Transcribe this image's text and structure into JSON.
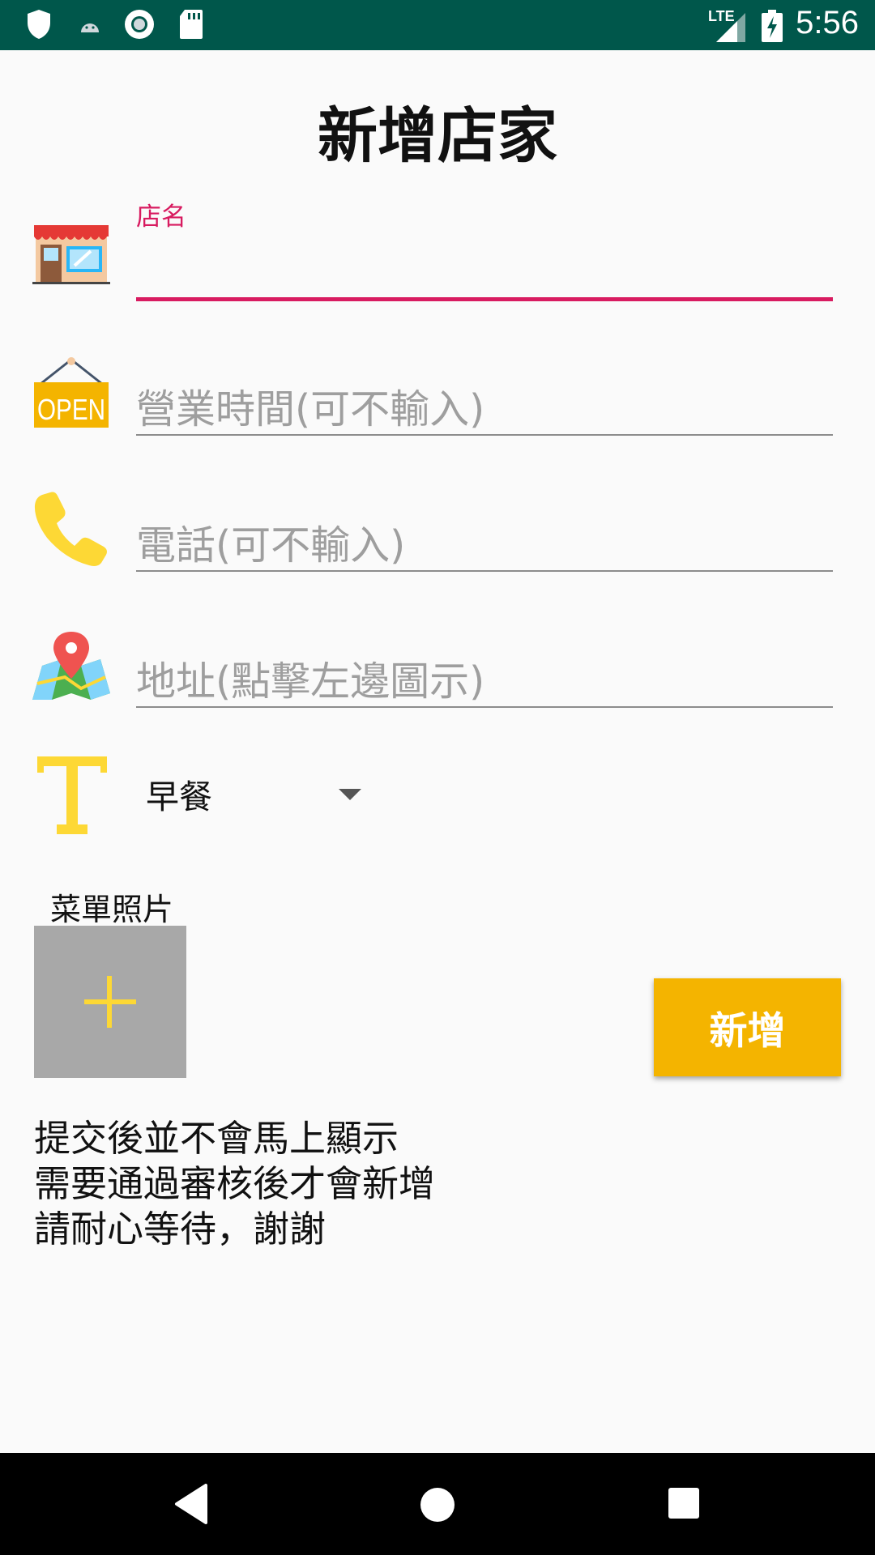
{
  "status_bar": {
    "time": "5:56",
    "network": "LTE",
    "icons": [
      "shield-icon",
      "android-icon",
      "circle-notification-icon",
      "sd-card-icon",
      "signal-icon",
      "battery-charging-icon"
    ]
  },
  "page": {
    "title": "新增店家"
  },
  "form": {
    "store_name": {
      "label": "店名",
      "value": "",
      "icon": "store-icon"
    },
    "hours": {
      "placeholder": "營業時間(可不輸入)",
      "icon": "open-sign-icon"
    },
    "phone": {
      "placeholder": "電話(可不輸入)",
      "icon": "phone-icon"
    },
    "address": {
      "placeholder": "地址(點擊左邊圖示)",
      "icon": "map-pin-icon"
    },
    "category": {
      "selected": "早餐",
      "icon": "text-type-icon"
    },
    "menu_photo": {
      "label": "菜單照片",
      "icon": "plus-icon"
    },
    "submit_label": "新增"
  },
  "notice": {
    "lines": [
      "提交後並不會馬上顯示",
      "需要通過審核後才會新增",
      "請耐心等待，謝謝"
    ]
  },
  "colors": {
    "status_bar": "#00574b",
    "accent": "#d81b60",
    "button": "#f4b400",
    "icon_yellow": "#fdd835"
  }
}
